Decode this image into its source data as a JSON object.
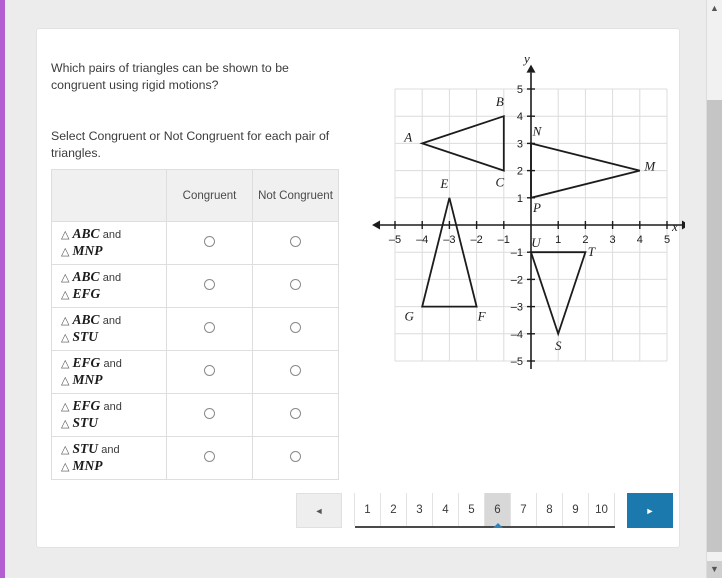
{
  "question": {
    "prompt": "Which pairs of triangles can be shown to be congruent using rigid motions?",
    "instruction": "Select Congruent or Not Congruent for each pair of triangles."
  },
  "table": {
    "headers": [
      "",
      "Congruent",
      "Not Congruent"
    ],
    "rows": [
      {
        "first": "ABC",
        "second": "MNP",
        "and": "and"
      },
      {
        "first": "ABC",
        "second": "EFG",
        "and": "and"
      },
      {
        "first": "ABC",
        "second": "STU",
        "and": "and"
      },
      {
        "first": "EFG",
        "second": "MNP",
        "and": "and"
      },
      {
        "first": "EFG",
        "second": "STU",
        "and": "and"
      },
      {
        "first": "STU",
        "second": "MNP",
        "and": "and"
      }
    ],
    "triangle_glyph": "△"
  },
  "chart_data": {
    "type": "scatter",
    "title": "",
    "xlabel": "x",
    "ylabel": "y",
    "xlim": [
      -5,
      5
    ],
    "ylim": [
      -5,
      5
    ],
    "grid": true,
    "xticks": [
      -5,
      -4,
      -3,
      -2,
      -1,
      1,
      2,
      3,
      4,
      5
    ],
    "yticks": [
      5,
      4,
      3,
      2,
      1,
      -1,
      -2,
      -3,
      -4,
      -5
    ],
    "xtick_labels": [
      "–5",
      "–4",
      "–3",
      "–2",
      "–1",
      "1",
      "2",
      "3",
      "4",
      "5"
    ],
    "ytick_labels": [
      "5",
      "4",
      "3",
      "2",
      "1",
      "–1",
      "–2",
      "–3",
      "–4",
      "–5"
    ],
    "series": [
      {
        "name": "Triangle ABC",
        "points": [
          {
            "label": "A",
            "x": -4,
            "y": 3,
            "label_dx": -14,
            "label_dy": -2
          },
          {
            "label": "B",
            "x": -1,
            "y": 4,
            "label_dx": -4,
            "label_dy": -10
          },
          {
            "label": "C",
            "x": -1,
            "y": 2,
            "label_dx": -4,
            "label_dy": 16
          }
        ]
      },
      {
        "name": "Triangle MNP",
        "points": [
          {
            "label": "N",
            "x": 0,
            "y": 3,
            "label_dx": 6,
            "label_dy": -8
          },
          {
            "label": "M",
            "x": 4,
            "y": 2,
            "label_dx": 10,
            "label_dy": 0
          },
          {
            "label": "P",
            "x": 0,
            "y": 1,
            "label_dx": 6,
            "label_dy": 14
          }
        ]
      },
      {
        "name": "Triangle EFG",
        "points": [
          {
            "label": "E",
            "x": -3,
            "y": 1,
            "label_dx": -5,
            "label_dy": -10
          },
          {
            "label": "F",
            "x": -2,
            "y": -3,
            "label_dx": 5,
            "label_dy": 14
          },
          {
            "label": "G",
            "x": -4,
            "y": -3,
            "label_dx": -13,
            "label_dy": 14
          }
        ]
      },
      {
        "name": "Triangle STU",
        "points": [
          {
            "label": "U",
            "x": 0,
            "y": -1,
            "label_dx": 5,
            "label_dy": -5
          },
          {
            "label": "T",
            "x": 2,
            "y": -1,
            "label_dx": 6,
            "label_dy": 4
          },
          {
            "label": "S",
            "x": 1,
            "y": -4,
            "label_dx": 0,
            "label_dy": 16
          }
        ]
      }
    ],
    "axis_label_x": "x",
    "axis_label_y": "y"
  },
  "pagination": {
    "prev_icon": "◄",
    "next_icon": "►",
    "pages": [
      "1",
      "2",
      "3",
      "4",
      "5",
      "6",
      "7",
      "8",
      "9",
      "10"
    ],
    "active_page": "6"
  },
  "scrollbar": {
    "up_icon": "▲",
    "down_icon": "▼"
  },
  "colors": {
    "accent_purple": "#b25dd0",
    "next_blue": "#1c79ad",
    "caret_blue": "#2e83bf",
    "page_active_bg": "#d8d8d8"
  }
}
